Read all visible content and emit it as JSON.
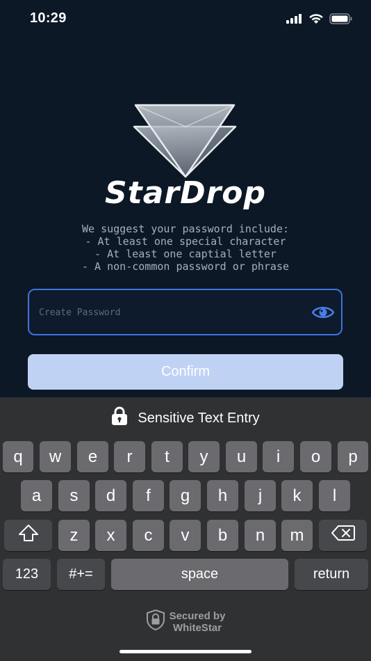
{
  "status_bar": {
    "time": "10:29",
    "icons": [
      "signal-icon",
      "wifi-icon",
      "battery-icon"
    ]
  },
  "brand": {
    "name": "StarDrop",
    "logo_icon": "star-triangle-logo-icon"
  },
  "hint": {
    "line1": "We suggest your password include:",
    "line2": "- At least one special character",
    "line3": "- At least one captial letter",
    "line4": "- A non-common password or phrase"
  },
  "password_field": {
    "value": "",
    "placeholder": "Create Password",
    "toggle_icon": "eye-icon",
    "border_color": "#3f73e0"
  },
  "confirm_button": {
    "label": "Confirm",
    "color": "#c0d2f4"
  },
  "keyboard": {
    "header": "Sensitive Text Entry",
    "header_icon": "lock-icon",
    "row1": [
      "q",
      "w",
      "e",
      "r",
      "t",
      "y",
      "u",
      "i",
      "o",
      "p"
    ],
    "row2": [
      "a",
      "s",
      "d",
      "f",
      "g",
      "h",
      "j",
      "k",
      "l"
    ],
    "row3": [
      "z",
      "x",
      "c",
      "v",
      "b",
      "n",
      "m"
    ],
    "shift_icon": "shift-icon",
    "delete_icon": "backspace-icon",
    "numbers_label": "123",
    "symbols_label": "#+=",
    "space_label": "space",
    "return_label": "return",
    "secured_line1": "Secured by",
    "secured_line2": "WhiteStar",
    "secured_icon": "shield-lock-icon"
  },
  "colors": {
    "background": "#0c1826",
    "keyboard_bg": "#303133",
    "key_bg": "#6b6b6f",
    "func_key_bg": "#47484c"
  }
}
